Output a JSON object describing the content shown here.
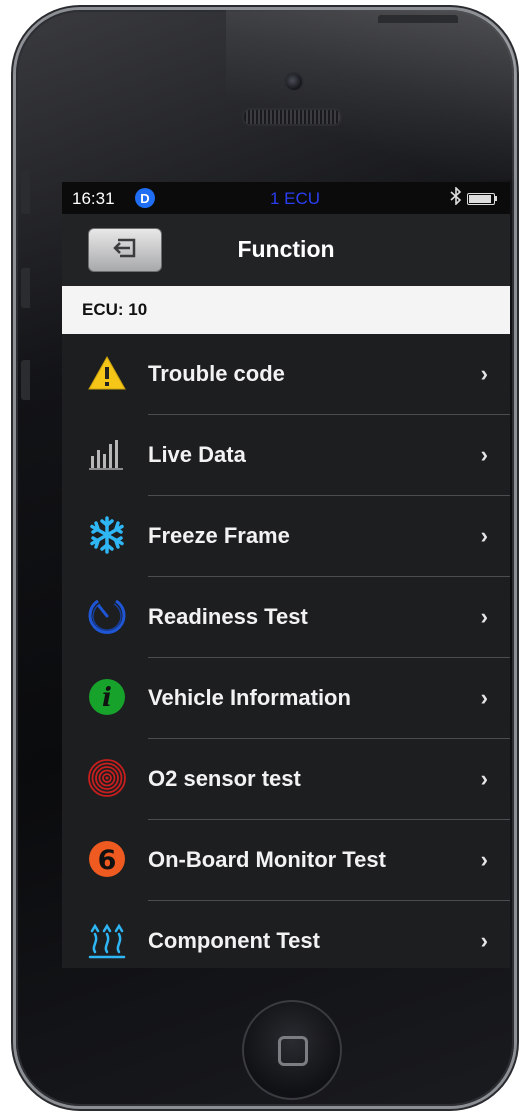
{
  "status_bar": {
    "time": "16:31",
    "badge": "D",
    "ecu_count": "1 ECU",
    "bluetooth_icon": "bluetooth-icon",
    "battery_level": 0.9
  },
  "nav": {
    "title": "Function",
    "back_icon": "back-arrow-icon"
  },
  "ecu_header": "ECU: 10",
  "menu": [
    {
      "label": "Trouble code",
      "icon": "warning-icon",
      "chevron": "›"
    },
    {
      "label": "Live Data",
      "icon": "bar-chart-icon",
      "chevron": "›"
    },
    {
      "label": "Freeze Frame",
      "icon": "snowflake-icon",
      "chevron": "›"
    },
    {
      "label": "Readiness Test",
      "icon": "timer-icon",
      "chevron": "›"
    },
    {
      "label": "Vehicle Information",
      "icon": "info-icon",
      "chevron": "›"
    },
    {
      "label": "O2 sensor test",
      "icon": "target-rings-icon",
      "chevron": "›"
    },
    {
      "label": "On-Board Monitor Test",
      "icon": "number-six-icon",
      "icon_text": "6",
      "chevron": "›"
    },
    {
      "label": "Component Test",
      "icon": "heat-waves-icon",
      "chevron": "›"
    }
  ],
  "colors": {
    "screen_bg": "#1d1e20",
    "ecu_count": "#2a3ef2",
    "badge": "#1e6df2",
    "warning": "#f5c518",
    "freeze": "#2fb6f5",
    "readiness": "#1f56d6",
    "info": "#17a32b",
    "o2": "#c81e1e",
    "monitor": "#ee5a1f",
    "component": "#2fb6f5"
  }
}
